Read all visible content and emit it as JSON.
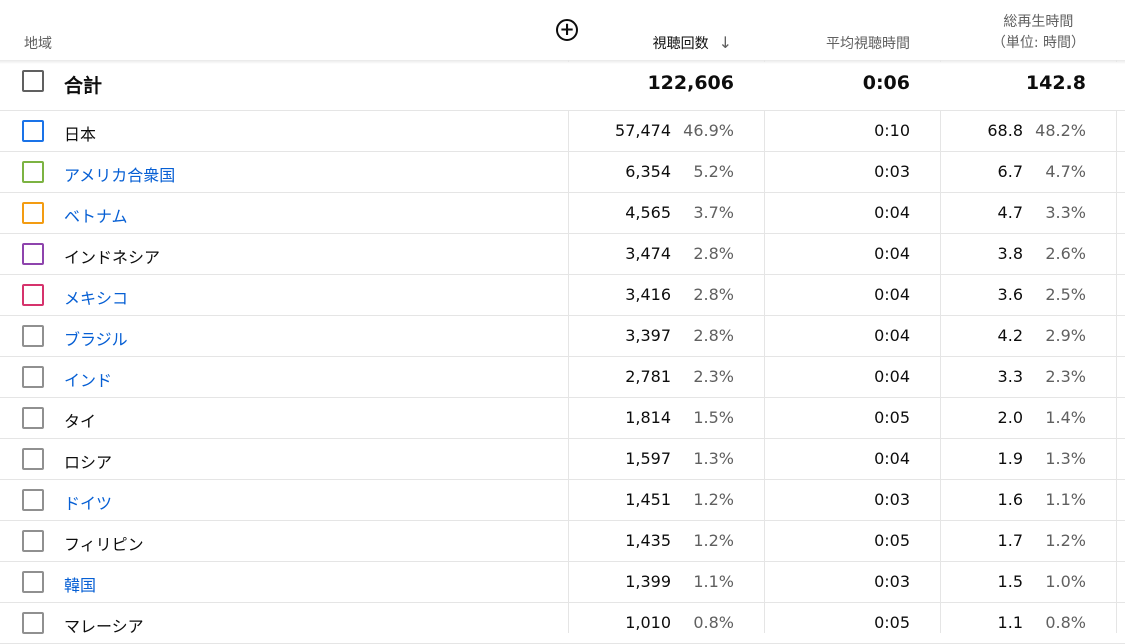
{
  "header": {
    "region": "地域",
    "views": "視聴回数",
    "sort_arrow": "↓",
    "avg_view": "平均視聴時間",
    "total_time_line1": "総再生時間",
    "total_time_line2": "（単位: 時間）",
    "add_icon": "+"
  },
  "total": {
    "label": "合計",
    "views": "122,606",
    "avg": "0:06",
    "watch": "142.8"
  },
  "rows": [
    {
      "name": "日本",
      "link": false,
      "color": "#1a73e8",
      "views": "57,474",
      "views_pct": "46.9%",
      "avg": "0:10",
      "watch": "68.8",
      "watch_pct": "48.2%"
    },
    {
      "name": "アメリカ合衆国",
      "link": true,
      "color": "#7cb342",
      "views": "6,354",
      "views_pct": "5.2%",
      "avg": "0:03",
      "watch": "6.7",
      "watch_pct": "4.7%"
    },
    {
      "name": "ベトナム",
      "link": true,
      "color": "#f39c12",
      "views": "4,565",
      "views_pct": "3.7%",
      "avg": "0:04",
      "watch": "4.7",
      "watch_pct": "3.3%"
    },
    {
      "name": "インドネシア",
      "link": false,
      "color": "#8e44ad",
      "views": "3,474",
      "views_pct": "2.8%",
      "avg": "0:04",
      "watch": "3.8",
      "watch_pct": "2.6%"
    },
    {
      "name": "メキシコ",
      "link": true,
      "color": "#d6336c",
      "views": "3,416",
      "views_pct": "2.8%",
      "avg": "0:04",
      "watch": "3.6",
      "watch_pct": "2.5%"
    },
    {
      "name": "ブラジル",
      "link": true,
      "color": "#909090",
      "views": "3,397",
      "views_pct": "2.8%",
      "avg": "0:04",
      "watch": "4.2",
      "watch_pct": "2.9%"
    },
    {
      "name": "インド",
      "link": true,
      "color": "#909090",
      "views": "2,781",
      "views_pct": "2.3%",
      "avg": "0:04",
      "watch": "3.3",
      "watch_pct": "2.3%"
    },
    {
      "name": "タイ",
      "link": false,
      "color": "#909090",
      "views": "1,814",
      "views_pct": "1.5%",
      "avg": "0:05",
      "watch": "2.0",
      "watch_pct": "1.4%"
    },
    {
      "name": "ロシア",
      "link": false,
      "color": "#909090",
      "views": "1,597",
      "views_pct": "1.3%",
      "avg": "0:04",
      "watch": "1.9",
      "watch_pct": "1.3%"
    },
    {
      "name": "ドイツ",
      "link": true,
      "color": "#909090",
      "views": "1,451",
      "views_pct": "1.2%",
      "avg": "0:03",
      "watch": "1.6",
      "watch_pct": "1.1%"
    },
    {
      "name": "フィリピン",
      "link": false,
      "color": "#909090",
      "views": "1,435",
      "views_pct": "1.2%",
      "avg": "0:05",
      "watch": "1.7",
      "watch_pct": "1.2%"
    },
    {
      "name": "韓国",
      "link": true,
      "color": "#909090",
      "views": "1,399",
      "views_pct": "1.1%",
      "avg": "0:03",
      "watch": "1.5",
      "watch_pct": "1.0%"
    },
    {
      "name": "マレーシア",
      "link": false,
      "color": "#909090",
      "views": "1,010",
      "views_pct": "0.8%",
      "avg": "0:05",
      "watch": "1.1",
      "watch_pct": "0.8%"
    }
  ]
}
